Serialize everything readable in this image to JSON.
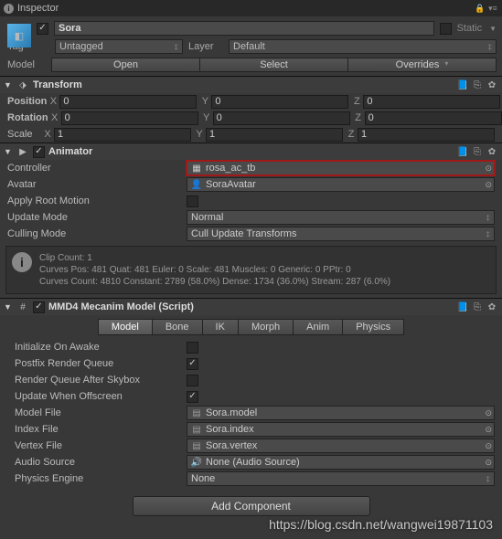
{
  "inspector": {
    "title": "Inspector",
    "gameobject_name": "Sora",
    "static_label": "Static",
    "tag_label": "Tag",
    "tag_value": "Untagged",
    "layer_label": "Layer",
    "layer_value": "Default",
    "model_label": "Model",
    "model_buttons": [
      "Open",
      "Select",
      "Overrides"
    ]
  },
  "transform": {
    "title": "Transform",
    "position_label": "Position",
    "rotation_label": "Rotation",
    "scale_label": "Scale",
    "position": {
      "x": "0",
      "y": "0",
      "z": "0"
    },
    "rotation": {
      "x": "0",
      "y": "0",
      "z": "0"
    },
    "scale": {
      "x": "1",
      "y": "1",
      "z": "1"
    }
  },
  "animator": {
    "title": "Animator",
    "controller_label": "Controller",
    "controller_value": "rosa_ac_tb",
    "avatar_label": "Avatar",
    "avatar_value": "SoraAvatar",
    "apply_root_label": "Apply Root Motion",
    "update_mode_label": "Update Mode",
    "update_mode_value": "Normal",
    "culling_mode_label": "Culling Mode",
    "culling_mode_value": "Cull Update Transforms",
    "info_line1": "Clip Count: 1",
    "info_line2": "Curves Pos: 481 Quat: 481 Euler: 0 Scale: 481 Muscles: 0 Generic: 0 PPtr: 0",
    "info_line3": "Curves Count: 4810 Constant: 2789 (58.0%) Dense: 1734 (36.0%) Stream: 287 (6.0%)"
  },
  "mmd": {
    "title": "MMD4 Mecanim Model (Script)",
    "tabs": [
      "Model",
      "Bone",
      "IK",
      "Morph",
      "Anim",
      "Physics"
    ],
    "init_awake_label": "Initialize On Awake",
    "postfix_label": "Postfix Render Queue",
    "render_skybox_label": "Render Queue After Skybox",
    "update_offscreen_label": "Update When Offscreen",
    "model_file_label": "Model File",
    "model_file_value": "Sora.model",
    "index_file_label": "Index File",
    "index_file_value": "Sora.index",
    "vertex_file_label": "Vertex File",
    "vertex_file_value": "Sora.vertex",
    "audio_source_label": "Audio Source",
    "audio_source_value": "None (Audio Source)",
    "physics_engine_label": "Physics Engine",
    "physics_engine_value": "None"
  },
  "add_component_label": "Add Component",
  "watermark": "https://blog.csdn.net/wangwei19871103"
}
